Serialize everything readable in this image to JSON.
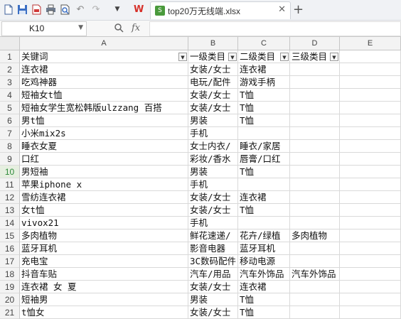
{
  "tab": {
    "title": "top20万无线端.xlsx"
  },
  "namebox": {
    "value": "K10"
  },
  "formula": {
    "fx_label": "fx",
    "value": ""
  },
  "columns": [
    "A",
    "B",
    "C",
    "D",
    "E"
  ],
  "rows": [
    {
      "n": "1",
      "cells": [
        "关键词",
        "一级类目",
        "二级类目",
        "三级类目",
        ""
      ]
    },
    {
      "n": "2",
      "cells": [
        "连衣裙",
        "女装/女士",
        "连衣裙",
        "",
        ""
      ]
    },
    {
      "n": "3",
      "cells": [
        "吃鸡神器",
        "电玩/配件",
        "游戏手柄",
        "",
        ""
      ]
    },
    {
      "n": "4",
      "cells": [
        "短袖女t恤",
        "女装/女士",
        "T恤",
        "",
        ""
      ]
    },
    {
      "n": "5",
      "cells": [
        "短袖女学生宽松韩版ulzzang 百搭",
        "女装/女士",
        "T恤",
        "",
        ""
      ]
    },
    {
      "n": "6",
      "cells": [
        "男t恤",
        "男装",
        "T恤",
        "",
        ""
      ]
    },
    {
      "n": "7",
      "cells": [
        "小米mix2s",
        "手机",
        "",
        "",
        ""
      ]
    },
    {
      "n": "8",
      "cells": [
        "睡衣女夏",
        "女士内衣/",
        "睡衣/家居",
        "",
        ""
      ]
    },
    {
      "n": "9",
      "cells": [
        "口红",
        "彩妆/香水",
        "唇膏/口红",
        "",
        ""
      ]
    },
    {
      "n": "10",
      "cells": [
        "男短袖",
        "男装",
        "T恤",
        "",
        ""
      ]
    },
    {
      "n": "11",
      "cells": [
        "苹果iphone x",
        "手机",
        "",
        "",
        ""
      ]
    },
    {
      "n": "12",
      "cells": [
        "雪纺连衣裙",
        "女装/女士",
        "连衣裙",
        "",
        ""
      ]
    },
    {
      "n": "13",
      "cells": [
        "女t恤",
        "女装/女士",
        "T恤",
        "",
        ""
      ]
    },
    {
      "n": "14",
      "cells": [
        "vivox21",
        "手机",
        "",
        "",
        ""
      ]
    },
    {
      "n": "15",
      "cells": [
        "多肉植物",
        "鲜花速递/",
        "花卉/绿植",
        "多肉植物",
        ""
      ]
    },
    {
      "n": "16",
      "cells": [
        "蓝牙耳机",
        "影音电器",
        "蓝牙耳机",
        "",
        ""
      ]
    },
    {
      "n": "17",
      "cells": [
        "充电宝",
        "3C数码配件",
        "移动电源",
        "",
        ""
      ]
    },
    {
      "n": "18",
      "cells": [
        "抖音车贴",
        "汽车/用品",
        "汽车外饰品",
        "汽车外饰品",
        ""
      ]
    },
    {
      "n": "19",
      "cells": [
        "连衣裙 女 夏",
        "女装/女士",
        "连衣裙",
        "",
        ""
      ]
    },
    {
      "n": "20",
      "cells": [
        "短袖男",
        "男装",
        "T恤",
        "",
        ""
      ]
    },
    {
      "n": "21",
      "cells": [
        "t恤女",
        "女装/女士",
        "T恤",
        "",
        ""
      ]
    }
  ],
  "active_row": "10",
  "icons": {
    "new": "new-file-icon",
    "save": "save-icon",
    "export_pdf": "pdf-icon",
    "print": "print-icon",
    "print_preview": "print-preview-icon",
    "undo": "undo-icon",
    "redo": "redo-icon",
    "more": "dropdown-icon",
    "wps": "wps-logo-icon",
    "sheet": "spreadsheet-icon",
    "close": "close-icon",
    "add": "add-tab-icon",
    "zoom": "zoom-icon",
    "filter": "filter-dropdown-icon"
  }
}
